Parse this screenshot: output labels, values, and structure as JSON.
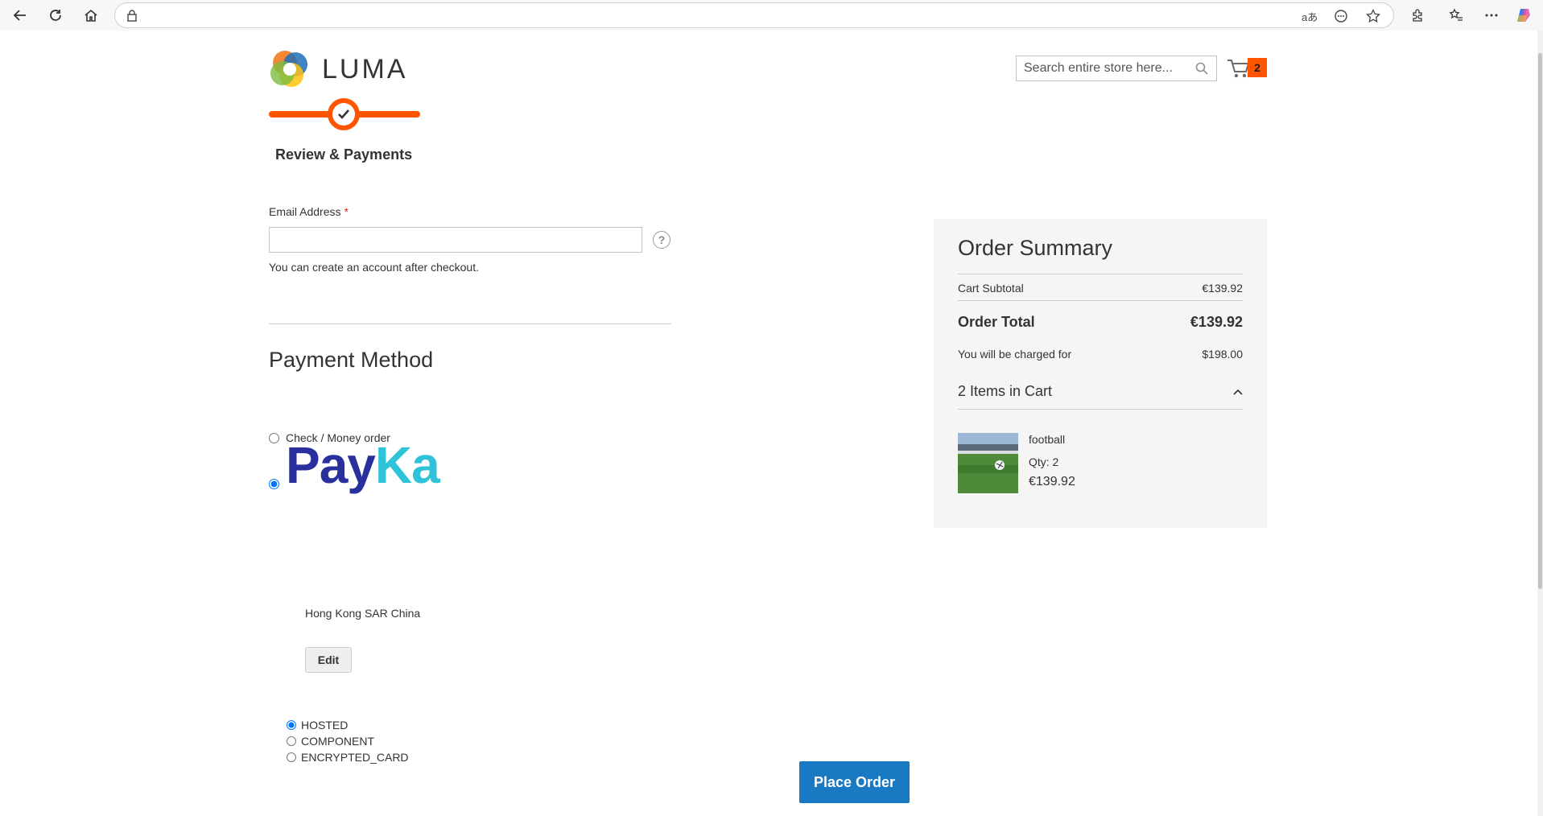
{
  "browser": {
    "address": "",
    "translate_icon": "aあ"
  },
  "header": {
    "logo_text": "LUMA",
    "search_placeholder": "Search entire store here...",
    "cart_count": "2"
  },
  "progress": {
    "step_label": "Review & Payments"
  },
  "email": {
    "label": "Email Address",
    "required_mark": "*",
    "value": "",
    "help_glyph": "?",
    "note": "You can create an account after checkout."
  },
  "payment": {
    "title": "Payment Method",
    "option_check": "Check / Money order",
    "paykka_logo_part1": "Pay",
    "paykka_logo_part2": "Ka",
    "country": "Hong Kong SAR China",
    "edit_label": "Edit",
    "flows": [
      "HOSTED",
      "COMPONENT",
      "ENCRYPTED_CARD"
    ]
  },
  "actions": {
    "place_order": "Place Order"
  },
  "summary": {
    "title": "Order Summary",
    "subtotal_label": "Cart Subtotal",
    "subtotal_value": "€139.92",
    "total_label": "Order Total",
    "total_value": "€139.92",
    "charged_label": "You will be charged for",
    "charged_value": "$198.00",
    "items_header": "2 Items in Cart",
    "item": {
      "name": "football",
      "qty": "Qty: 2",
      "price": "€139.92"
    }
  },
  "colors": {
    "accent_orange": "#ff5501",
    "button_blue": "#1979c3",
    "paykka_navy": "#2a2f9e",
    "paykka_cyan": "#2fc3d9"
  }
}
